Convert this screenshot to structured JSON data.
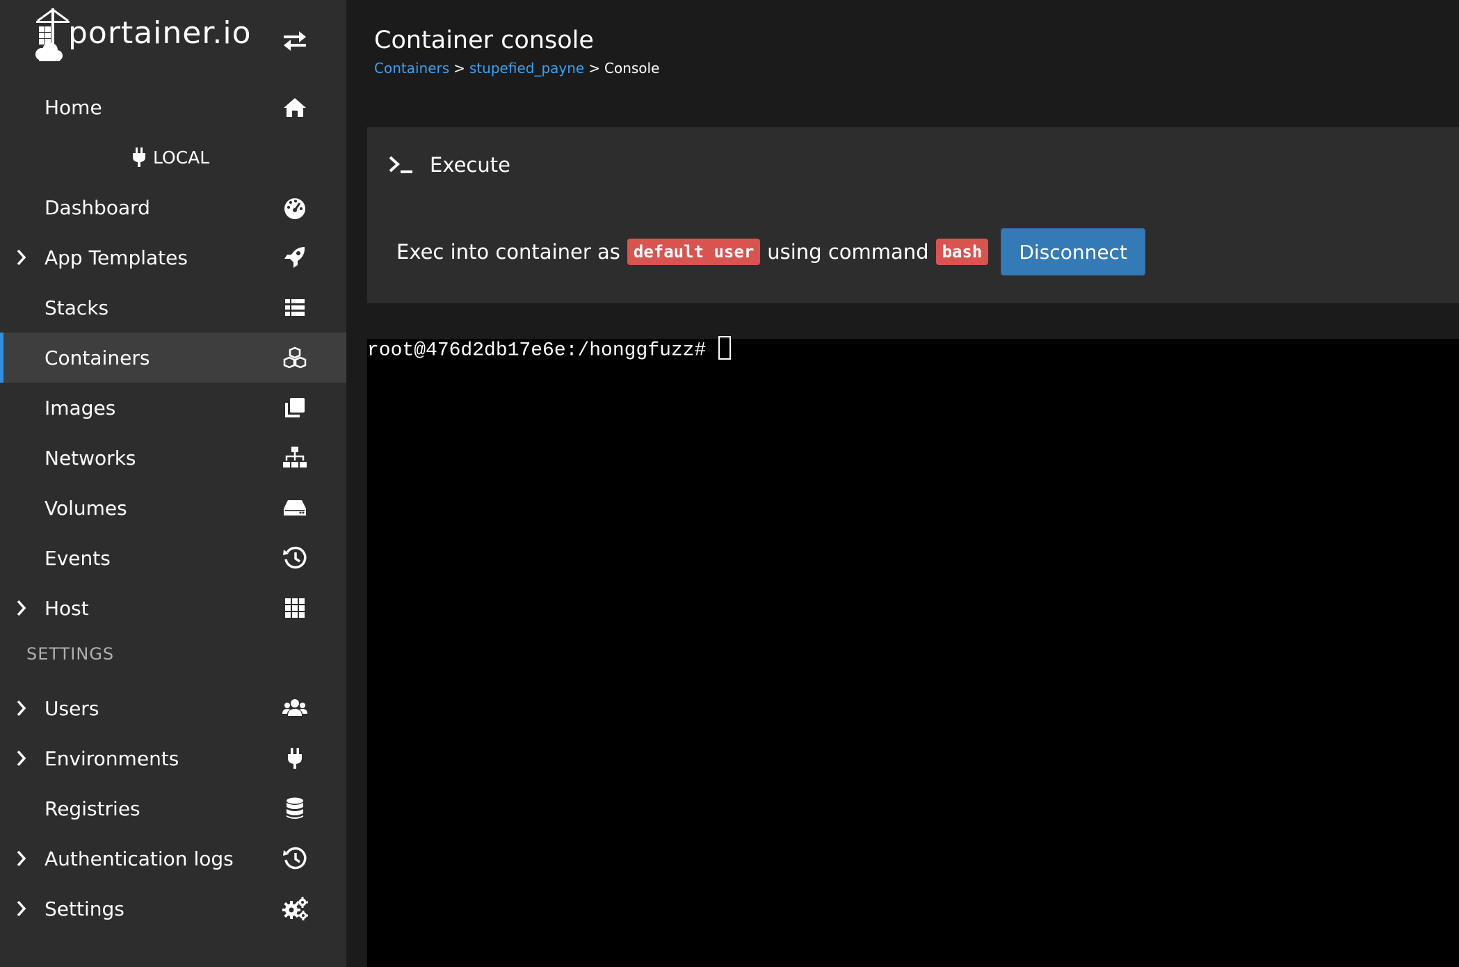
{
  "brand": {
    "name": "portainer.io"
  },
  "sidebar": {
    "home": {
      "label": "Home"
    },
    "environment": {
      "label": "LOCAL"
    },
    "items": [
      {
        "label": "Dashboard",
        "icon": "dashboard-icon",
        "chevron": false
      },
      {
        "label": "App Templates",
        "icon": "rocket-icon",
        "chevron": true
      },
      {
        "label": "Stacks",
        "icon": "list-icon",
        "chevron": false
      },
      {
        "label": "Containers",
        "icon": "cubes-icon",
        "chevron": false,
        "active": true
      },
      {
        "label": "Images",
        "icon": "clone-icon",
        "chevron": false
      },
      {
        "label": "Networks",
        "icon": "sitemap-icon",
        "chevron": false
      },
      {
        "label": "Volumes",
        "icon": "hdd-icon",
        "chevron": false
      },
      {
        "label": "Events",
        "icon": "history-icon",
        "chevron": false
      },
      {
        "label": "Host",
        "icon": "th-icon",
        "chevron": true
      }
    ],
    "settings_title": "SETTINGS",
    "settings_items": [
      {
        "label": "Users",
        "icon": "users-icon",
        "chevron": true
      },
      {
        "label": "Environments",
        "icon": "plug-icon",
        "chevron": true
      },
      {
        "label": "Registries",
        "icon": "database-icon",
        "chevron": false
      },
      {
        "label": "Authentication logs",
        "icon": "history-icon",
        "chevron": true
      },
      {
        "label": "Settings",
        "icon": "cogs-icon",
        "chevron": true
      }
    ]
  },
  "header": {
    "title": "Container console",
    "breadcrumb": {
      "containers": "Containers",
      "container_name": "stupefied_payne",
      "current": "Console",
      "separator": ">"
    }
  },
  "execute_panel": {
    "title": "Execute",
    "exec_text_1": "Exec into container as",
    "user": "default user",
    "exec_text_2": "using command",
    "command": "bash",
    "disconnect_label": "Disconnect"
  },
  "terminal": {
    "prompt": "root@476d2db17e6e:/honggfuzz#"
  },
  "colors": {
    "sidebar_bg": "#2d2d2d",
    "main_bg": "#1b1b1b",
    "accent": "#3ba0f2",
    "button_primary": "#337ab7",
    "badge_red": "#d9534f",
    "terminal_bg": "#000000"
  }
}
